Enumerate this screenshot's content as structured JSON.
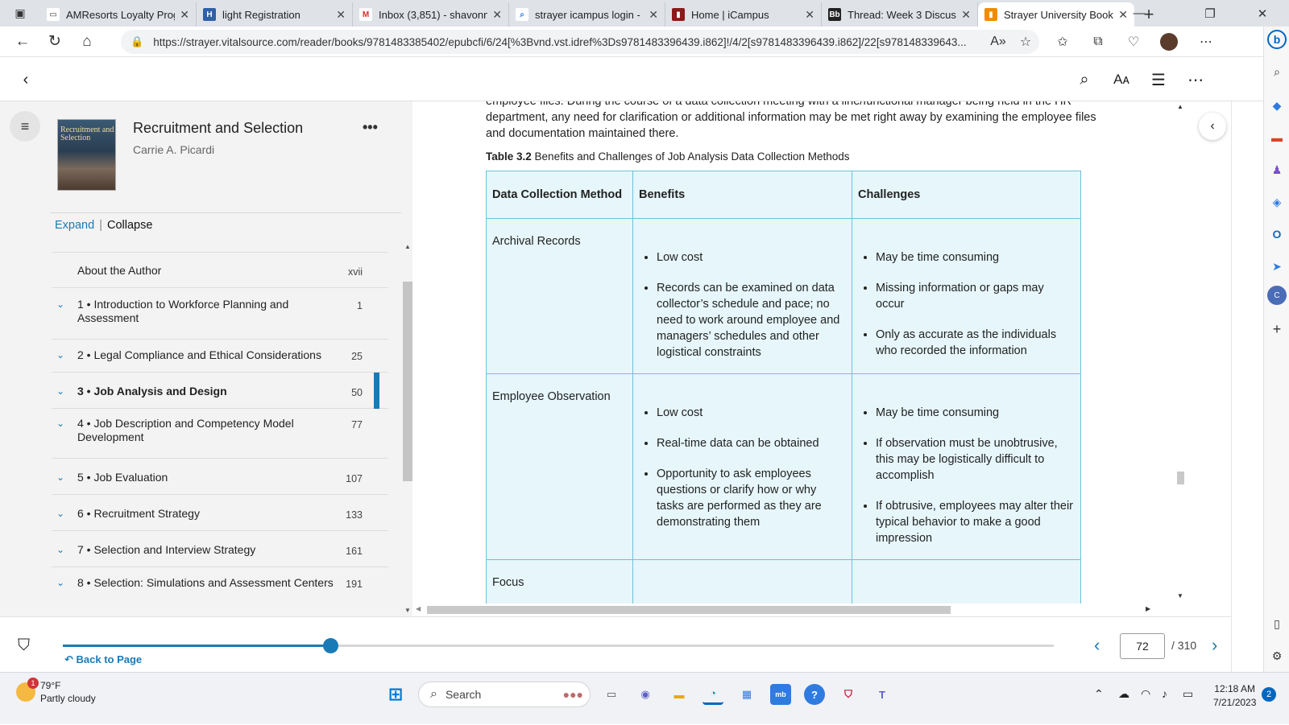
{
  "browser": {
    "tabs": [
      {
        "title": "AMResorts Loyalty Prog",
        "icon": "document-icon"
      },
      {
        "title": "light Registration",
        "icon": "h-icon"
      },
      {
        "title": "Inbox (3,851) - shavonn",
        "icon": "gmail-icon"
      },
      {
        "title": "strayer icampus login -",
        "icon": "search-icon"
      },
      {
        "title": "Home | iCampus",
        "icon": "strayer-icon"
      },
      {
        "title": "Thread: Week 3 Discuss",
        "icon": "blackboard-icon"
      },
      {
        "title": "Strayer University Book",
        "icon": "bookshelf-icon"
      }
    ],
    "url": "https://strayer.vitalsource.com/reader/books/9781483385402/epubcfi/6/24[%3Bvnd.vst.idref%3Ds9781483396439.i862]!/4/2[s9781483396439.i862]/22[s978148339643..."
  },
  "book": {
    "title": "Recruitment and Selection",
    "author": "Carrie A. Picardi",
    "cover_text": "Recruitment and Selection"
  },
  "toc": {
    "expand_label": "Expand",
    "collapse_label": "Collapse",
    "items": [
      {
        "label": "About the Author",
        "page": "xvii",
        "expandable": false,
        "active": false
      },
      {
        "label": "1 • Introduction to Workforce Planning and Assessment",
        "page": "1",
        "expandable": true,
        "active": false
      },
      {
        "label": "2 • Legal Compliance and Ethical Considerations",
        "page": "25",
        "expandable": true,
        "active": false
      },
      {
        "label": "3 • Job Analysis and Design",
        "page": "50",
        "expandable": true,
        "active": true
      },
      {
        "label": "4 • Job Description and Competency Model Development",
        "page": "77",
        "expandable": true,
        "active": false
      },
      {
        "label": "5 • Job Evaluation",
        "page": "107",
        "expandable": true,
        "active": false
      },
      {
        "label": "6 • Recruitment Strategy",
        "page": "133",
        "expandable": true,
        "active": false
      },
      {
        "label": "7 • Selection and Interview Strategy",
        "page": "161",
        "expandable": true,
        "active": false
      },
      {
        "label": "8 • Selection: Simulations and Assessment Centers",
        "page": "191",
        "expandable": true,
        "active": false
      }
    ]
  },
  "content": {
    "paragraph": "employee files. During the course of a data collection meeting with a line/functional manager being held in the HR department, any need for clarification or additional information may be met right away by examining the employee files and documentation maintained there.",
    "table_caption_label": "Table 3.2",
    "table_caption_text": "Benefits and Challenges of Job Analysis Data Collection Methods",
    "table": {
      "headers": [
        "Data Collection Method",
        "Benefits",
        "Challenges"
      ],
      "rows": [
        {
          "method": "Archival Records",
          "benefits": [
            "Low cost",
            "Records can be examined on data collector’s schedule and pace; no need to work around employee and managers’ schedules and other logistical constraints"
          ],
          "challenges": [
            "May be time consuming",
            "Missing information or gaps may occur",
            "Only as accurate as the individuals who recorded the information"
          ]
        },
        {
          "method": "Employee Observation",
          "benefits": [
            "Low cost",
            "Real-time data can be obtained",
            "Opportunity to ask employees questions or clarify how or why tasks are performed as they are demonstrating them"
          ],
          "challenges": [
            "May be time consuming",
            "If observation must be unobtrusive, this may be logistically difficult to accomplish",
            "If obtrusive, employees may alter their typical behavior to make a good impression"
          ]
        },
        {
          "method": "Focus",
          "benefits": [],
          "challenges": []
        }
      ]
    }
  },
  "pager": {
    "back_to_page": "Back to Page",
    "current_page": "72",
    "total": "/ 310",
    "progress": 0.27
  },
  "taskbar": {
    "weather_temp": "79°F",
    "weather_desc": "Partly cloudy",
    "weather_badge": "1",
    "search_label": "Search",
    "time": "12:18 AM",
    "date": "7/21/2023",
    "notifications": "2"
  }
}
